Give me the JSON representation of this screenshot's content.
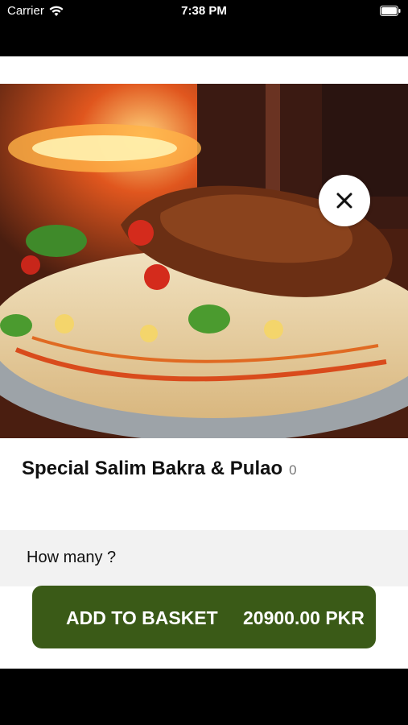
{
  "status_bar": {
    "carrier": "Carrier",
    "time": "7:38 PM"
  },
  "hero": {
    "image_alt_icon": "dish-photo"
  },
  "item": {
    "title": "Special Salim Bakra & Pulao",
    "count": "0"
  },
  "quantity": {
    "label": "How many ?"
  },
  "basket_button": {
    "label": "ADD TO BASKET",
    "price": "20900.00 PKR"
  },
  "colors": {
    "accent_button": "#3a5a17",
    "stepper_red": "#d22"
  }
}
